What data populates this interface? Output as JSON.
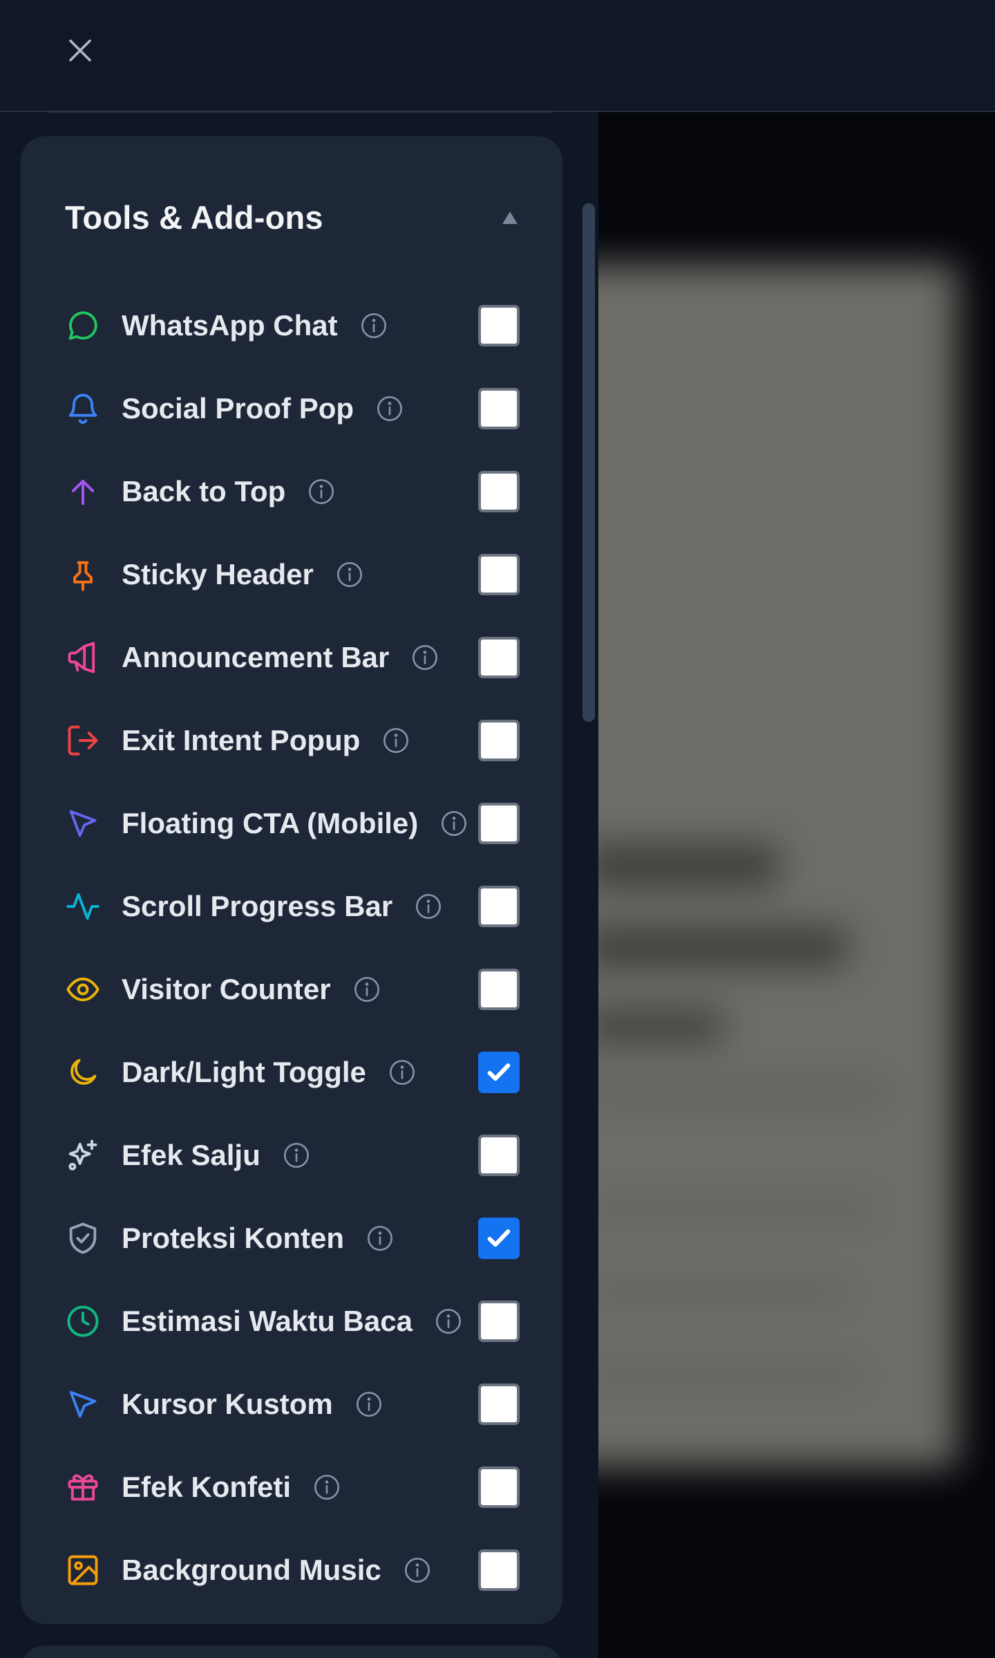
{
  "section": {
    "title": "Tools & Add-ons",
    "collapse_icon": "triangle-up-icon"
  },
  "topbar": {
    "close_icon": "close-icon"
  },
  "items": [
    {
      "key": "whatsapp-chat",
      "label": "WhatsApp Chat",
      "icon": "whatsapp-icon",
      "color": "#22c55e",
      "checked": false
    },
    {
      "key": "social-proof-pop",
      "label": "Social Proof Pop",
      "icon": "bell-icon",
      "color": "#3b82f6",
      "checked": false
    },
    {
      "key": "back-to-top",
      "label": "Back to Top",
      "icon": "arrow-up-icon",
      "color": "#a855f7",
      "checked": false
    },
    {
      "key": "sticky-header",
      "label": "Sticky Header",
      "icon": "pin-icon",
      "color": "#f97316",
      "checked": false
    },
    {
      "key": "announcement-bar",
      "label": "Announcement Bar",
      "icon": "megaphone-icon",
      "color": "#ec4899",
      "checked": false
    },
    {
      "key": "exit-intent-popup",
      "label": "Exit Intent Popup",
      "icon": "log-out-icon",
      "color": "#ef4444",
      "checked": false
    },
    {
      "key": "floating-cta-mobile",
      "label": "Floating CTA (Mobile)",
      "icon": "cursor-pointer-icon",
      "color": "#6366f1",
      "checked": false
    },
    {
      "key": "scroll-progress-bar",
      "label": "Scroll Progress Bar",
      "icon": "activity-icon",
      "color": "#06b6d4",
      "checked": false
    },
    {
      "key": "visitor-counter",
      "label": "Visitor Counter",
      "icon": "eye-icon",
      "color": "#eab308",
      "checked": false
    },
    {
      "key": "dark-light-toggle",
      "label": "Dark/Light Toggle",
      "icon": "moon-icon",
      "color": "#eab308",
      "checked": true
    },
    {
      "key": "efek-salju",
      "label": "Efek Salju",
      "icon": "sparkles-icon",
      "color": "#cbd5e1",
      "checked": false
    },
    {
      "key": "proteksi-konten",
      "label": "Proteksi Konten",
      "icon": "shield-check-icon",
      "color": "#94a3b8",
      "checked": true
    },
    {
      "key": "estimasi-waktu-baca",
      "label": "Estimasi Waktu Baca",
      "icon": "clock-icon",
      "color": "#10b981",
      "checked": false
    },
    {
      "key": "kursor-kustom",
      "label": "Kursor Kustom",
      "icon": "cursor-pointer-icon",
      "color": "#3b82f6",
      "checked": false
    },
    {
      "key": "efek-konfeti",
      "label": "Efek Konfeti",
      "icon": "gift-icon",
      "color": "#ec4899",
      "checked": false
    },
    {
      "key": "background-music",
      "label": "Background Music",
      "icon": "image-icon",
      "color": "#f59e0b",
      "checked": false
    }
  ]
}
